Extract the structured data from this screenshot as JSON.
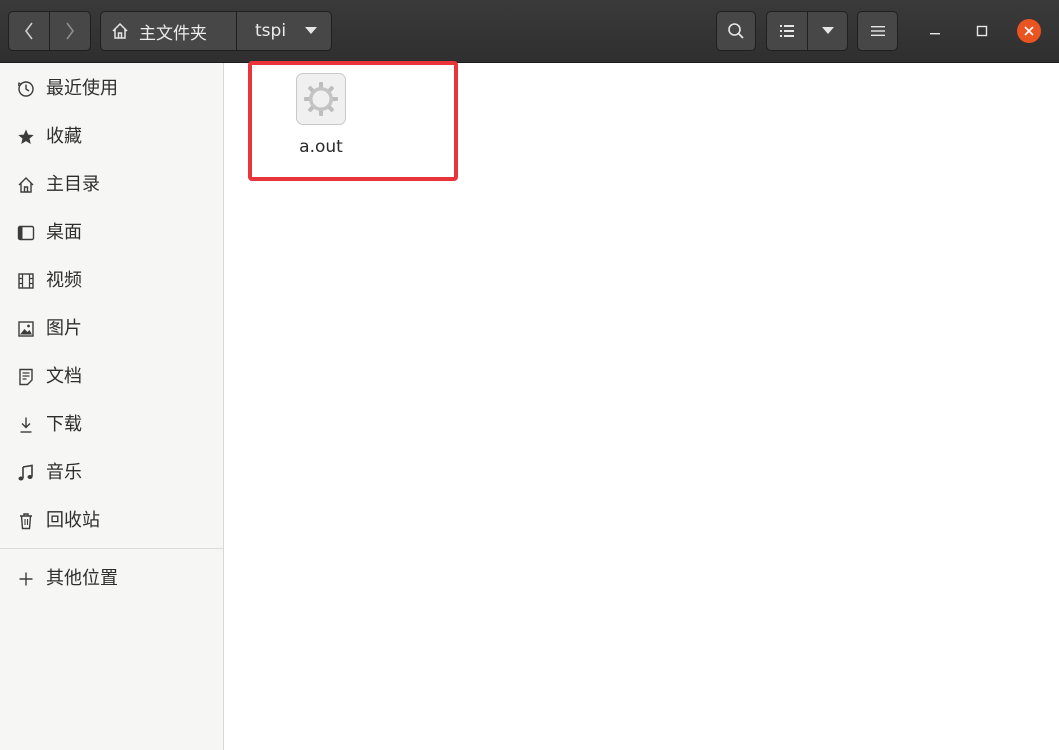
{
  "header": {
    "breadcrumb": {
      "home_label": "主文件夹",
      "current_folder": "tspi"
    }
  },
  "sidebar": {
    "items": [
      {
        "label": "最近使用",
        "icon": "clock-icon"
      },
      {
        "label": "收藏",
        "icon": "star-icon"
      },
      {
        "label": "主目录",
        "icon": "home-icon"
      },
      {
        "label": "桌面",
        "icon": "desktop-icon"
      },
      {
        "label": "视频",
        "icon": "film-icon"
      },
      {
        "label": "图片",
        "icon": "image-icon"
      },
      {
        "label": "文档",
        "icon": "document-icon"
      },
      {
        "label": "下载",
        "icon": "download-icon"
      },
      {
        "label": "音乐",
        "icon": "music-icon"
      },
      {
        "label": "回收站",
        "icon": "trash-icon"
      }
    ],
    "other_locations": {
      "label": "其他位置",
      "icon": "plus-icon"
    }
  },
  "files": [
    {
      "name": "a.out",
      "icon": "executable-gear-icon"
    }
  ],
  "colors": {
    "accent_close": "#e95420",
    "highlight_box": "#e8343a",
    "header_bg": "#333333",
    "sidebar_bg": "#f6f6f5"
  }
}
